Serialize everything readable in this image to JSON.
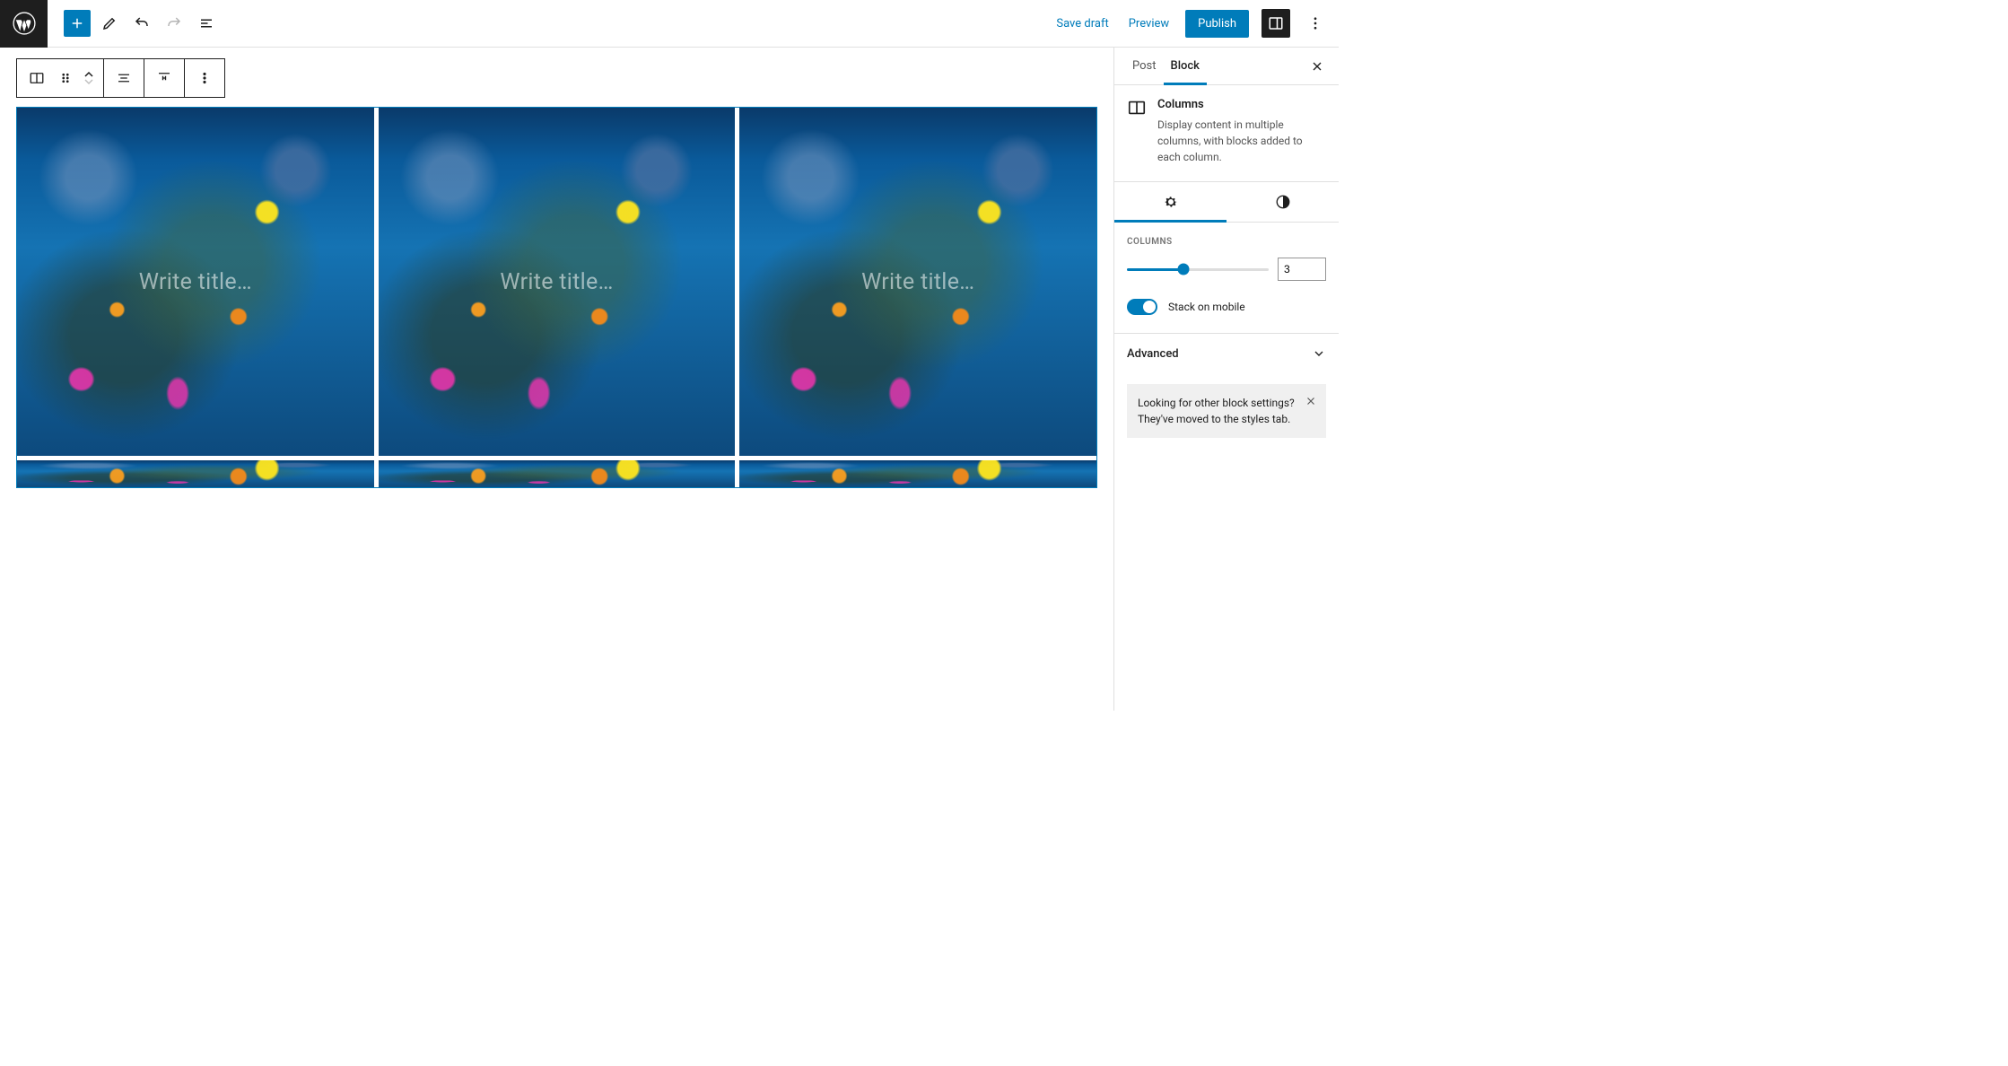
{
  "topbar": {
    "save_draft": "Save draft",
    "preview": "Preview",
    "publish": "Publish"
  },
  "block_toolbar": {
    "icons": [
      "columns",
      "drag",
      "move-updown",
      "align",
      "vertical-align",
      "more"
    ]
  },
  "columns_block": {
    "placeholder": "Write title…",
    "count": 3
  },
  "sidebar": {
    "tabs": {
      "post": "Post",
      "block": "Block",
      "active": "block"
    },
    "block_info": {
      "title": "Columns",
      "description": "Display content in multiple columns, with blocks added to each column."
    },
    "subtabs": {
      "active": "settings"
    },
    "columns_panel": {
      "label": "COLUMNS",
      "value": "3",
      "min": 1,
      "max": 6,
      "fill_percent": 40
    },
    "stack_toggle": {
      "label": "Stack on mobile",
      "checked": true
    },
    "advanced_label": "Advanced",
    "notice": "Looking for other block settings? They've moved to the styles tab."
  }
}
